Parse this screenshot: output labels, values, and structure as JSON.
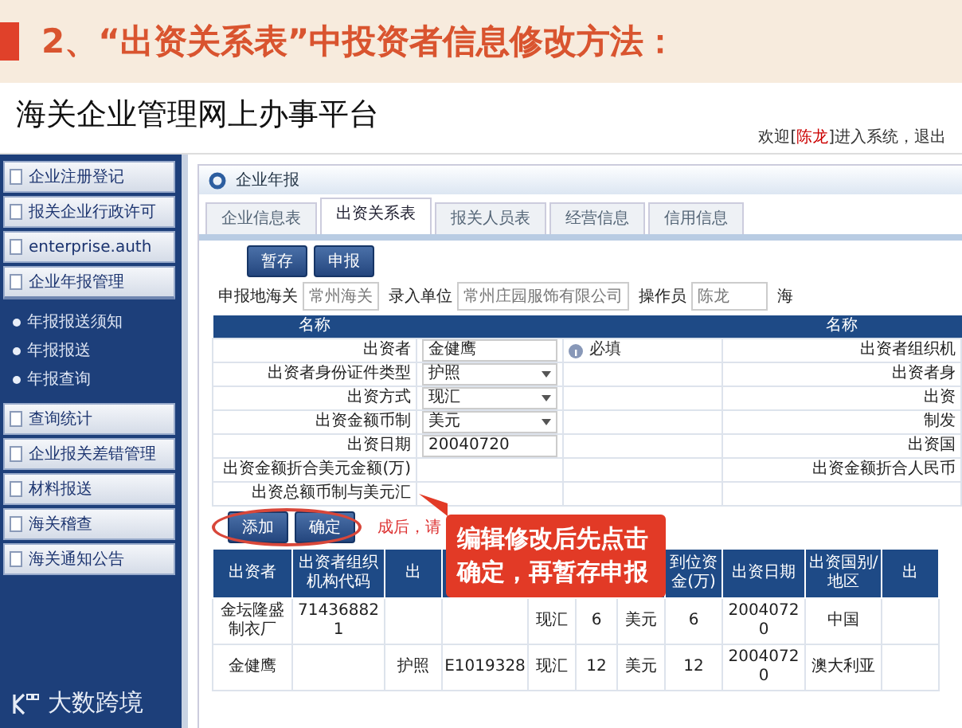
{
  "slide": {
    "heading": "2、“出资关系表”中投资者信息修改方法：",
    "brand": "大数跨境"
  },
  "app": {
    "title": "海关企业管理网上办事平台",
    "welcome_prefix": "欢迎[",
    "user": "陈龙",
    "welcome_suffix": "]进入系统，",
    "logout": "退出"
  },
  "sidebar": {
    "items": [
      {
        "label": "企业注册登记"
      },
      {
        "label": "报关企业行政许可"
      },
      {
        "label": "enterprise.auth"
      },
      {
        "label": "企业年报管理",
        "expanded": true,
        "children": [
          {
            "label": "年报报送须知"
          },
          {
            "label": "年报报送"
          },
          {
            "label": "年报查询"
          }
        ]
      },
      {
        "label": "查询统计"
      },
      {
        "label": "企业报关差错管理"
      },
      {
        "label": "材料报送"
      },
      {
        "label": "海关稽查"
      },
      {
        "label": "海关通知公告"
      }
    ]
  },
  "panel": {
    "title": "企业年报",
    "tabs": [
      {
        "label": "企业信息表",
        "selected": false
      },
      {
        "label": "出资关系表",
        "selected": true
      },
      {
        "label": "报关人员表",
        "selected": false
      },
      {
        "label": "经营信息",
        "selected": false
      },
      {
        "label": "信用信息",
        "selected": false
      }
    ],
    "buttons": [
      "暂存",
      "申报"
    ],
    "fields": [
      {
        "label": "申报地海关",
        "value": "常州海关"
      },
      {
        "label": "录入单位",
        "value": "常州庄园服饰有限公司"
      },
      {
        "label": "操作员",
        "value": "陈龙"
      },
      {
        "label": "海"
      }
    ]
  },
  "form": {
    "headers": [
      "名称",
      "名称"
    ],
    "rows": [
      {
        "label": "出资者",
        "kind": "text",
        "value": "金健鹰",
        "hint": "必填",
        "right_label": "出资者组织机"
      },
      {
        "label": "出资者身份证件类型",
        "kind": "select",
        "value": "护照",
        "right_label": "出资者身"
      },
      {
        "label": "出资方式",
        "kind": "select",
        "value": "现汇",
        "right_label": "出资"
      },
      {
        "label": "出资金额币制",
        "kind": "select",
        "value": "美元",
        "right_label": "制发"
      },
      {
        "label": "出资日期",
        "kind": "text",
        "value": "20040720",
        "right_label": "出资国"
      },
      {
        "label": "出资金额折合美元金额(万)",
        "kind": "none",
        "right_label": "出资金额折合人民币"
      },
      {
        "label": "出资总额币制与美元汇",
        "kind": "none"
      }
    ],
    "actions": [
      "添加",
      "确定"
    ],
    "note": "成后，请"
  },
  "callout": {
    "lines": [
      "编辑修改后先点击",
      "确定，再暂存申报"
    ]
  },
  "table": {
    "columns": [
      "出资者",
      "出资者组织机构代码",
      "出",
      null,
      null,
      null,
      null,
      "到位资金(万)",
      "出资日期",
      "出资国别/地区",
      "出"
    ],
    "rows": [
      [
        "金坛隆盛制衣厂",
        "714368821",
        null,
        null,
        "现汇",
        "6",
        "美元",
        "6",
        "20040720",
        "中国",
        null
      ],
      [
        "金健鹰",
        null,
        "护照",
        "E1019328",
        "现汇",
        "12",
        "美元",
        "12",
        "20040720",
        "澳大利亚",
        null
      ]
    ]
  }
}
